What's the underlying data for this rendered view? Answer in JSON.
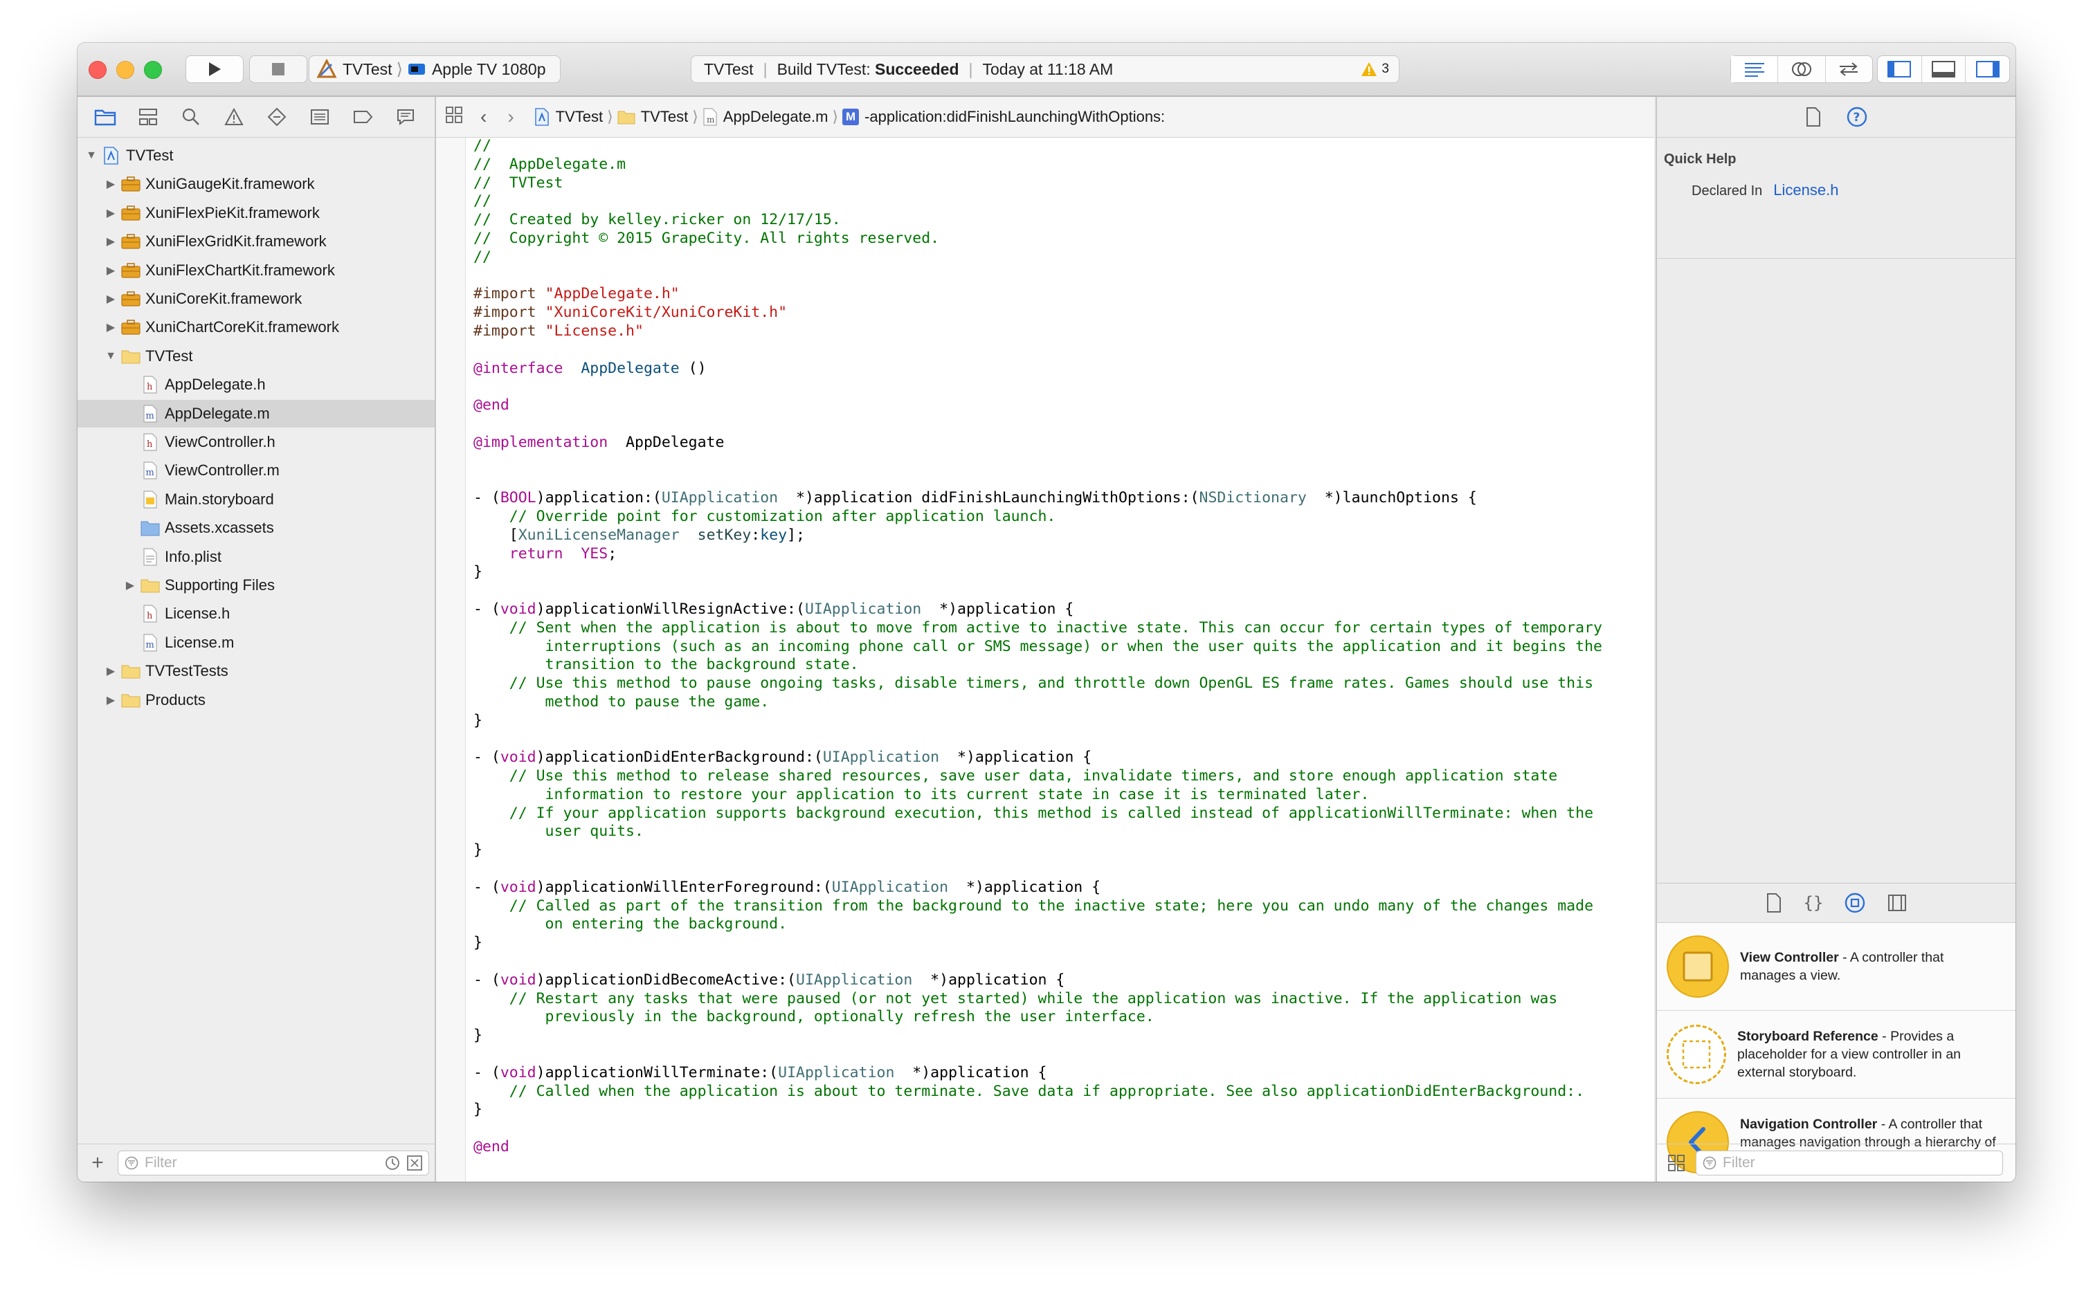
{
  "toolbar": {
    "scheme_name": "TVTest",
    "destination": "Apple TV 1080p",
    "activity_project": "TVTest",
    "activity_build_prefix": "Build TVTest: ",
    "activity_build_status": "Succeeded",
    "activity_time": "Today at 11:18 AM",
    "warning_count": "3",
    "colors": {
      "close": "#fc605c",
      "minimize": "#fdbc40",
      "zoom": "#34c84a",
      "accent": "#1d73e8",
      "warning": "#f2b300"
    }
  },
  "navigator": {
    "tabs": [
      "folder-icon",
      "symbol-icon",
      "find-icon",
      "issue-icon",
      "test-icon",
      "debug-icon",
      "breakpoint-icon",
      "report-icon"
    ],
    "items": [
      {
        "label": "TVTest",
        "type": "project",
        "disclosure": "open"
      },
      {
        "label": "XuniGaugeKit.framework",
        "type": "framework",
        "disclosure": "closed"
      },
      {
        "label": "XuniFlexPieKit.framework",
        "type": "framework",
        "disclosure": "closed"
      },
      {
        "label": "XuniFlexGridKit.framework",
        "type": "framework",
        "disclosure": "closed"
      },
      {
        "label": "XuniFlexChartKit.framework",
        "type": "framework",
        "disclosure": "closed"
      },
      {
        "label": "XuniCoreKit.framework",
        "type": "framework",
        "disclosure": "closed"
      },
      {
        "label": "XuniChartCoreKit.framework",
        "type": "framework",
        "disclosure": "closed"
      },
      {
        "label": "TVTest",
        "type": "group",
        "disclosure": "open"
      },
      {
        "label": "AppDelegate.h",
        "type": "h"
      },
      {
        "label": "AppDelegate.m",
        "type": "m",
        "selected": true
      },
      {
        "label": "ViewController.h",
        "type": "h"
      },
      {
        "label": "ViewController.m",
        "type": "m"
      },
      {
        "label": "Main.storyboard",
        "type": "storyboard"
      },
      {
        "label": "Assets.xcassets",
        "type": "assets"
      },
      {
        "label": "Info.plist",
        "type": "plist"
      },
      {
        "label": "Supporting Files",
        "type": "group",
        "disclosure": "closed"
      },
      {
        "label": "License.h",
        "type": "h"
      },
      {
        "label": "License.m",
        "type": "m"
      },
      {
        "label": "TVTestTests",
        "type": "group",
        "disclosure": "closed"
      },
      {
        "label": "Products",
        "type": "group",
        "disclosure": "closed"
      }
    ],
    "filter_placeholder": "Filter"
  },
  "jumpbar": {
    "crumbs": [
      "TVTest",
      "TVTest",
      "AppDelegate.m",
      "-application:didFinishLaunchingWithOptions:"
    ]
  },
  "editor": {
    "lines": [
      [
        [
          "cm",
          "//"
        ]
      ],
      [
        [
          "cm",
          "//  AppDelegate.m"
        ]
      ],
      [
        [
          "cm",
          "//  TVTest"
        ]
      ],
      [
        [
          "cm",
          "//"
        ]
      ],
      [
        [
          "cm",
          "//  Created by kelley.ricker on 12/17/15."
        ]
      ],
      [
        [
          "cm",
          "//  Copyright © 2015 GrapeCity. All rights reserved."
        ]
      ],
      [
        [
          "cm",
          "//"
        ]
      ],
      [],
      [
        [
          "pp",
          "#import "
        ],
        [
          "st",
          "\"AppDelegate.h\""
        ]
      ],
      [
        [
          "pp",
          "#import "
        ],
        [
          "st",
          "\"XuniCoreKit/XuniCoreKit.h\""
        ]
      ],
      [
        [
          "pp",
          "#import "
        ],
        [
          "st",
          "\"License.h\""
        ]
      ],
      [],
      [
        [
          "kw",
          "@interface"
        ],
        [
          "",
          "  "
        ],
        [
          "pj",
          "AppDelegate"
        ],
        [
          "",
          "",
          " ()"
        ]
      ],
      [],
      [
        [
          "kw",
          "@end"
        ]
      ],
      [],
      [
        [
          "kw",
          "@implementation"
        ],
        [
          "",
          "  AppDelegate"
        ]
      ],
      [],
      [],
      [
        [
          "",
          "- ("
        ],
        [
          "kw",
          "BOOL"
        ],
        [
          "",
          ")application:("
        ],
        [
          "ty",
          "UIApplication"
        ],
        [
          "",
          "  *)application didFinishLaunchingWithOptions:("
        ],
        [
          "ty",
          "NSDictionary"
        ],
        [
          "",
          "  *)launchOptions {"
        ]
      ],
      [
        [
          "cm",
          "    // Override point for customization after application launch."
        ]
      ],
      [
        [
          "",
          "    ["
        ],
        [
          "ty",
          "XuniLicenseManager"
        ],
        [
          "",
          "  "
        ],
        [
          "fn",
          "setKey"
        ],
        [
          "",
          ":"
        ],
        [
          "pj",
          "key"
        ],
        [
          "",
          "];"
        ]
      ],
      [
        [
          "",
          "    "
        ],
        [
          "kw",
          "return"
        ],
        [
          "",
          "  "
        ],
        [
          "kw",
          "YES"
        ],
        [
          "",
          ";"
        ]
      ],
      [
        [
          "",
          "}"
        ]
      ],
      [],
      [
        [
          "",
          "- ("
        ],
        [
          "kw",
          "void"
        ],
        [
          "",
          ")applicationWillResignActive:("
        ],
        [
          "ty",
          "UIApplication"
        ],
        [
          "",
          "  *)application {"
        ]
      ],
      [
        [
          "cm",
          "    // Sent when the application is about to move from active to inactive state. This can occur for certain types of temporary"
        ]
      ],
      [
        [
          "cm",
          "        interruptions (such as an incoming phone call or SMS message) or when the user quits the application and it begins the"
        ]
      ],
      [
        [
          "cm",
          "        transition to the background state."
        ]
      ],
      [
        [
          "cm",
          "    // Use this method to pause ongoing tasks, disable timers, and throttle down OpenGL ES frame rates. Games should use this"
        ]
      ],
      [
        [
          "cm",
          "        method to pause the game."
        ]
      ],
      [
        [
          "",
          "}"
        ]
      ],
      [],
      [
        [
          "",
          "- ("
        ],
        [
          "kw",
          "void"
        ],
        [
          "",
          ")applicationDidEnterBackground:("
        ],
        [
          "ty",
          "UIApplication"
        ],
        [
          "",
          "  *)application {"
        ]
      ],
      [
        [
          "cm",
          "    // Use this method to release shared resources, save user data, invalidate timers, and store enough application state"
        ]
      ],
      [
        [
          "cm",
          "        information to restore your application to its current state in case it is terminated later."
        ]
      ],
      [
        [
          "cm",
          "    // If your application supports background execution, this method is called instead of applicationWillTerminate: when the"
        ]
      ],
      [
        [
          "cm",
          "        user quits."
        ]
      ],
      [
        [
          "",
          "}"
        ]
      ],
      [],
      [
        [
          "",
          "- ("
        ],
        [
          "kw",
          "void"
        ],
        [
          "",
          ")applicationWillEnterForeground:("
        ],
        [
          "ty",
          "UIApplication"
        ],
        [
          "",
          "  *)application {"
        ]
      ],
      [
        [
          "cm",
          "    // Called as part of the transition from the background to the inactive state; here you can undo many of the changes made"
        ]
      ],
      [
        [
          "cm",
          "        on entering the background."
        ]
      ],
      [
        [
          "",
          "}"
        ]
      ],
      [],
      [
        [
          "",
          "- ("
        ],
        [
          "kw",
          "void"
        ],
        [
          "",
          ")applicationDidBecomeActive:("
        ],
        [
          "ty",
          "UIApplication"
        ],
        [
          "",
          "  *)application {"
        ]
      ],
      [
        [
          "cm",
          "    // Restart any tasks that were paused (or not yet started) while the application was inactive. If the application was"
        ]
      ],
      [
        [
          "cm",
          "        previously in the background, optionally refresh the user interface."
        ]
      ],
      [
        [
          "",
          "}"
        ]
      ],
      [],
      [
        [
          "",
          "- ("
        ],
        [
          "kw",
          "void"
        ],
        [
          "",
          ")applicationWillTerminate:("
        ],
        [
          "ty",
          "UIApplication"
        ],
        [
          "",
          "  *)application {"
        ]
      ],
      [
        [
          "cm",
          "    // Called when the application is about to terminate. Save data if appropriate. See also applicationDidEnterBackground:."
        ]
      ],
      [
        [
          "",
          "}"
        ]
      ],
      [],
      [
        [
          "kw",
          "@end"
        ]
      ]
    ]
  },
  "inspector": {
    "quick_help_title": "Quick Help",
    "declared_in_label": "Declared In",
    "declared_in_value": "License.h",
    "library": [
      {
        "title": "View Controller",
        "desc": " - A controller that manages a view.",
        "icon": "view-controller-icon"
      },
      {
        "title": "Storyboard Reference",
        "desc": " - Provides a placeholder for a view controller in an external storyboard.",
        "icon": "storyboard-reference-icon"
      },
      {
        "title": "Navigation Controller",
        "desc": " - A controller that manages navigation through a hierarchy of views.",
        "icon": "navigation-controller-icon"
      }
    ],
    "filter_placeholder": "Filter"
  }
}
